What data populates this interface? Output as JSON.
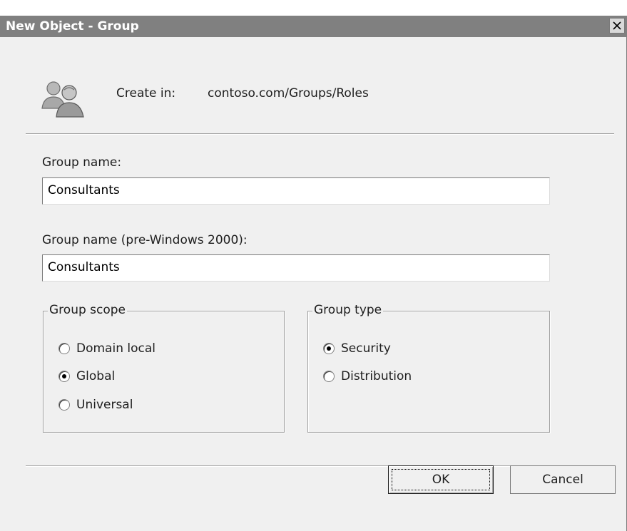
{
  "window": {
    "title": "New Object - Group",
    "close_glyph": "✕"
  },
  "header": {
    "icon": "users-group-icon",
    "create_in_label": "Create in:",
    "create_in_path": "contoso.com/Groups/Roles"
  },
  "form": {
    "group_name_label": "Group name:",
    "group_name_value": "Consultants",
    "group_name_pre2000_label": "Group name (pre-Windows 2000):",
    "group_name_pre2000_value": "Consultants"
  },
  "group_scope": {
    "legend": "Group scope",
    "options": [
      {
        "label": "Domain local",
        "checked": false
      },
      {
        "label": "Global",
        "checked": true
      },
      {
        "label": "Universal",
        "checked": false
      }
    ]
  },
  "group_type": {
    "legend": "Group type",
    "options": [
      {
        "label": "Security",
        "checked": true
      },
      {
        "label": "Distribution",
        "checked": false
      }
    ]
  },
  "buttons": {
    "ok_label": "OK",
    "cancel_label": "Cancel"
  },
  "colors": {
    "titlebar": "#808080",
    "dialog_bg": "#f0f0f0",
    "field_bg": "#ffffff"
  }
}
